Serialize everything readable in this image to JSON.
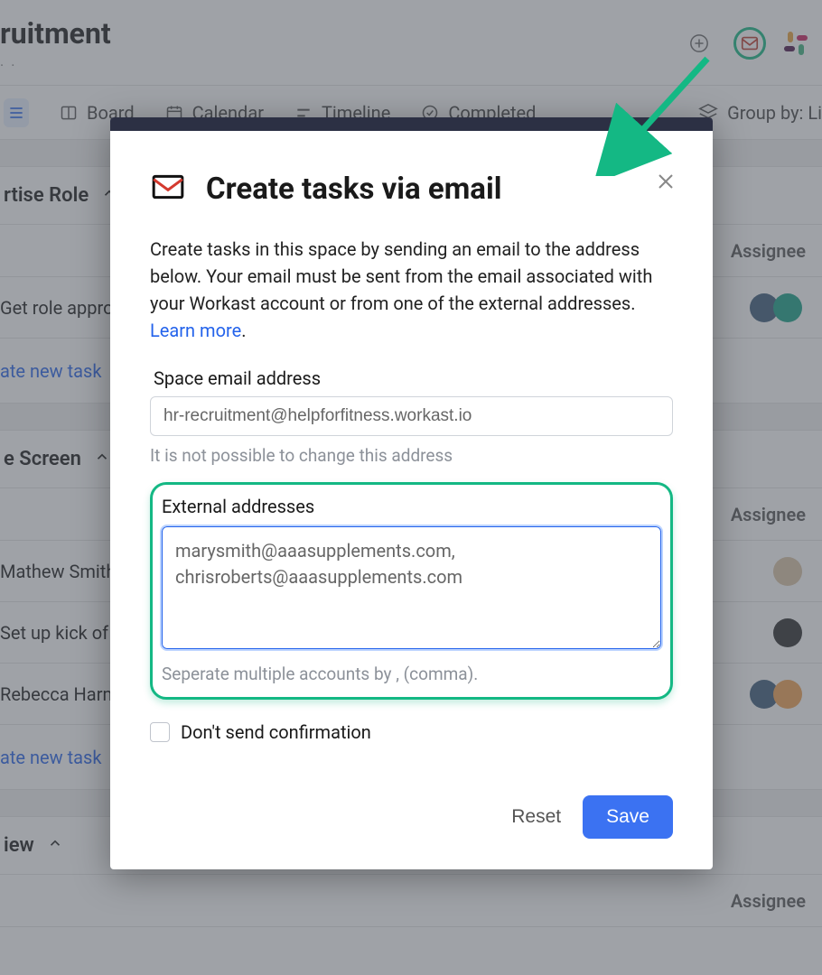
{
  "header": {
    "title_fragment": "ruitment",
    "plus_icon": "plus-circle-icon",
    "email_icon": "envelope-icon",
    "slack_icon": "slack-icon"
  },
  "nav": {
    "list_label": "",
    "board_label": "Board",
    "calendar_label": "Calendar",
    "timeline_label": "Timeline",
    "completed_label": "Completed",
    "group_by_label": "Group by: Li"
  },
  "sections": [
    {
      "title_fragment": "rtise Role",
      "assignee_header": "Assignee",
      "rows": [
        {
          "label": "Get role appro",
          "avatars": [
            "a1",
            "a2"
          ]
        }
      ],
      "create_label": "ate new task"
    },
    {
      "title_fragment": "e Screen",
      "assignee_header": "Assignee",
      "rows": [
        {
          "label": "Mathew Smith",
          "avatars": [
            "a3"
          ]
        },
        {
          "label": "Set up kick of m",
          "avatars": [
            "a4"
          ]
        },
        {
          "label": "Rebecca Harm",
          "avatars": [
            "a1",
            "a5"
          ]
        }
      ],
      "create_label": "ate new task"
    },
    {
      "title_fragment": "iew",
      "assignee_header": "Assignee",
      "rows": [],
      "create_label": ""
    }
  ],
  "modal": {
    "title": "Create tasks via email",
    "description": "Create tasks in this space by sending an email to the address below. Your email must be sent from the email associated with your Workast account or from one of the external addresses. ",
    "learn_more": "Learn more",
    "space_label": "Space email address",
    "space_value": "hr-recruitment@helpforfitness.workast.io",
    "space_hint": "It is not possible to change this address",
    "ext_label": "External addresses",
    "ext_value": "marysmith@aaasupplements.com, chrisroberts@aaasupplements.com",
    "ext_hint": "Seperate multiple accounts by , (comma).",
    "confirm_label": "Don't send confirmation",
    "reset_label": "Reset",
    "save_label": "Save"
  }
}
